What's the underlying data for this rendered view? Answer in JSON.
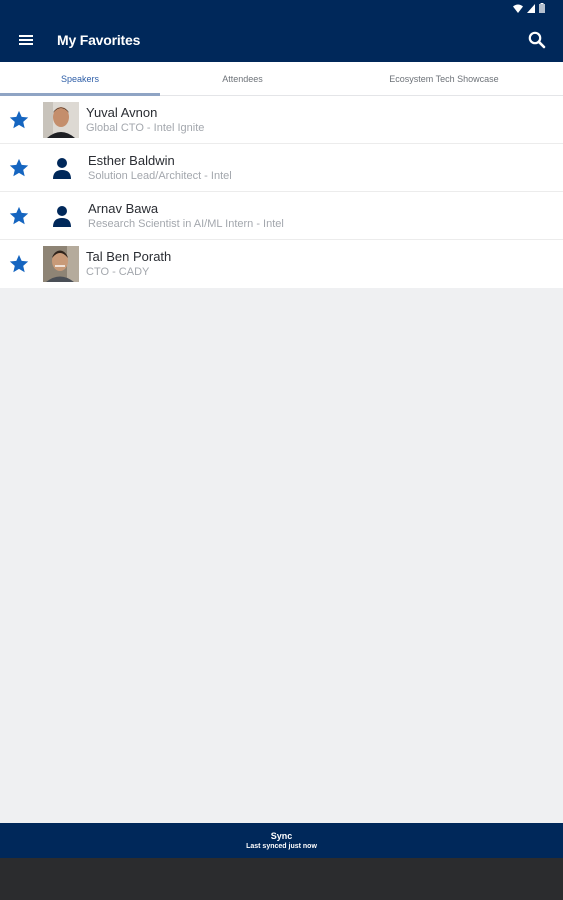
{
  "app": {
    "title": "My Favorites",
    "icons": {
      "menu": "menu-icon",
      "search": "search-icon"
    }
  },
  "tabs": [
    {
      "label": "Speakers",
      "active": true
    },
    {
      "label": "Attendees",
      "active": false
    },
    {
      "label": "Ecosystem Tech Showcase",
      "active": false
    }
  ],
  "favorites": [
    {
      "name": "Yuval Avnon",
      "subtitle": "Global CTO - Intel Ignite",
      "avatar": "photo",
      "favorited": true
    },
    {
      "name": "Esther Baldwin",
      "subtitle": "Solution Lead/Architect - Intel",
      "avatar": "person-icon",
      "favorited": true
    },
    {
      "name": "Arnav Bawa",
      "subtitle": "Research Scientist in AI/ML Intern - Intel",
      "avatar": "person-icon",
      "favorited": true
    },
    {
      "name": "Tal Ben Porath",
      "subtitle": "CTO - CADY",
      "avatar": "photo",
      "favorited": true
    }
  ],
  "sync": {
    "title": "Sync",
    "subtitle": "Last synced just now"
  },
  "colors": {
    "brand_navy": "#00285a",
    "star_blue": "#1565c0",
    "active_tab": "#2f5fa8"
  }
}
